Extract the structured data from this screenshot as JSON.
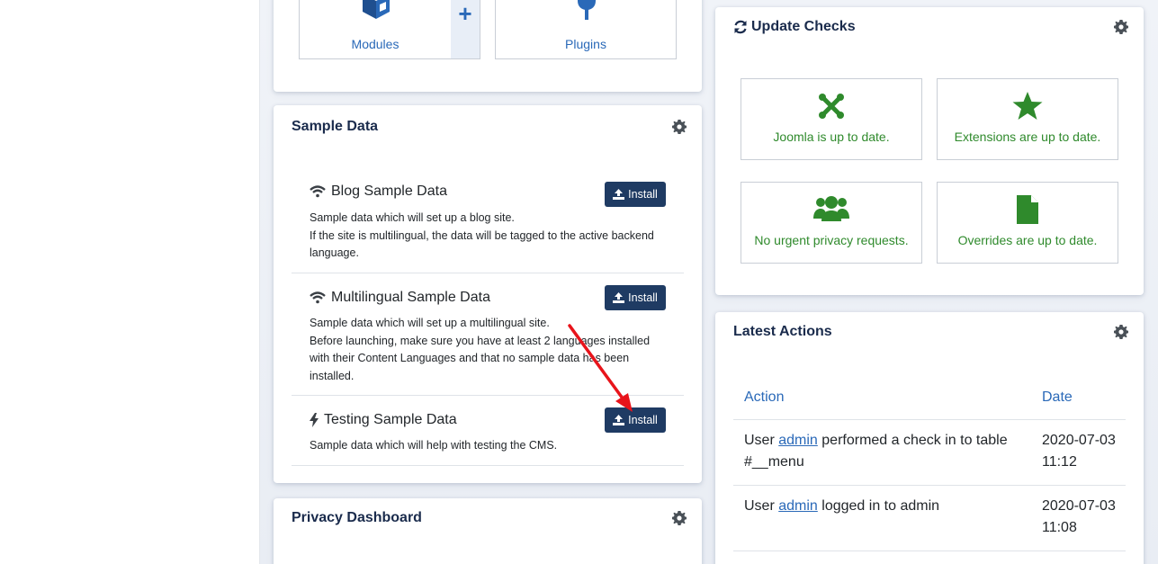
{
  "top_tiles": {
    "modules_label": "Modules",
    "plugins_label": "Plugins",
    "add_symbol": "+"
  },
  "sample_data": {
    "title": "Sample Data",
    "items": [
      {
        "icon": "wifi-icon",
        "title": "Blog Sample Data",
        "desc_lines": [
          "Sample data which will set up a blog site.",
          "If the site is multilingual, the data will be tagged to the active backend",
          "language."
        ],
        "button": "Install"
      },
      {
        "icon": "wifi-icon",
        "title": "Multilingual Sample Data",
        "desc_lines": [
          "Sample data which will set up a multilingual site.",
          "Before launching, make sure you have at least 2 languages installed",
          "with their Content Languages and that no sample data has been",
          "installed."
        ],
        "button": "Install"
      },
      {
        "icon": "bolt-icon",
        "title": "Testing Sample Data",
        "desc_lines": [
          "Sample data which will help with testing the CMS."
        ],
        "button": "Install"
      }
    ]
  },
  "privacy": {
    "title": "Privacy Dashboard"
  },
  "update_checks": {
    "title": "Update Checks",
    "tiles": [
      {
        "icon": "joomla-icon",
        "label": "Joomla is up to date."
      },
      {
        "icon": "star-icon",
        "label": "Extensions are up to date."
      },
      {
        "icon": "users-icon",
        "label": "No urgent privacy requests."
      },
      {
        "icon": "file-icon",
        "label": "Overrides are up to date."
      }
    ]
  },
  "latest_actions": {
    "title": "Latest Actions",
    "col_action": "Action",
    "col_date": "Date",
    "rows": [
      {
        "prefix": "User",
        "user": "admin",
        "suffix": "performed a check in to table",
        "suffix2": "#__menu",
        "date": "2020-07-03",
        "time": "11:12"
      },
      {
        "prefix": "User",
        "user": "admin",
        "suffix": "logged in to admin",
        "suffix2": "",
        "date": "2020-07-03",
        "time": "11:08"
      }
    ]
  },
  "colors": {
    "accent": "#2a69b8",
    "button": "#1f3b63",
    "success": "#2f8a2c",
    "annotation_arrow": "#e8141b"
  }
}
